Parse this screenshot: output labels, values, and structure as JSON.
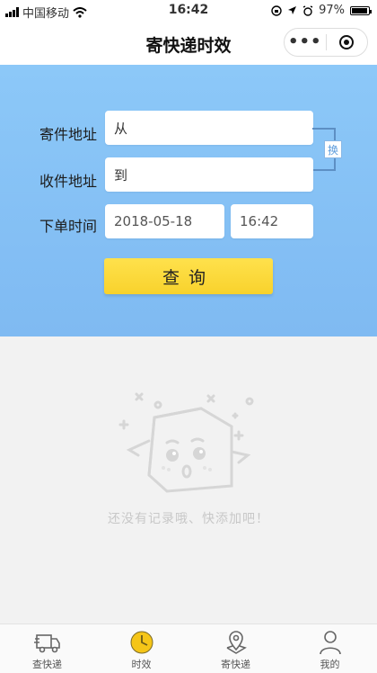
{
  "status_bar": {
    "carrier": "中国移动",
    "time": "16:42",
    "battery": "97%"
  },
  "navbar": {
    "title": "寄快递时效",
    "more_label": "•••"
  },
  "form": {
    "from_label": "寄件地址",
    "from_value": "从",
    "to_label": "收件地址",
    "to_value": "到",
    "time_label": "下单时间",
    "date_value": "2018-05-18",
    "time_value": "16:42",
    "swap_label": "换",
    "query_label": "查询"
  },
  "empty_state": {
    "message": "还没有记录哦、快添加吧！"
  },
  "tabbar": {
    "items": [
      {
        "label": "查快递",
        "icon": "truck-icon"
      },
      {
        "label": "时效",
        "icon": "clock-icon",
        "active": true
      },
      {
        "label": "寄快递",
        "icon": "map-pin-icon"
      },
      {
        "label": "我的",
        "icon": "person-icon"
      }
    ]
  },
  "colors": {
    "hero_top": "#8cc8f8",
    "accent_yellow": "#f8d22c",
    "active_tab": "#f5c518"
  }
}
